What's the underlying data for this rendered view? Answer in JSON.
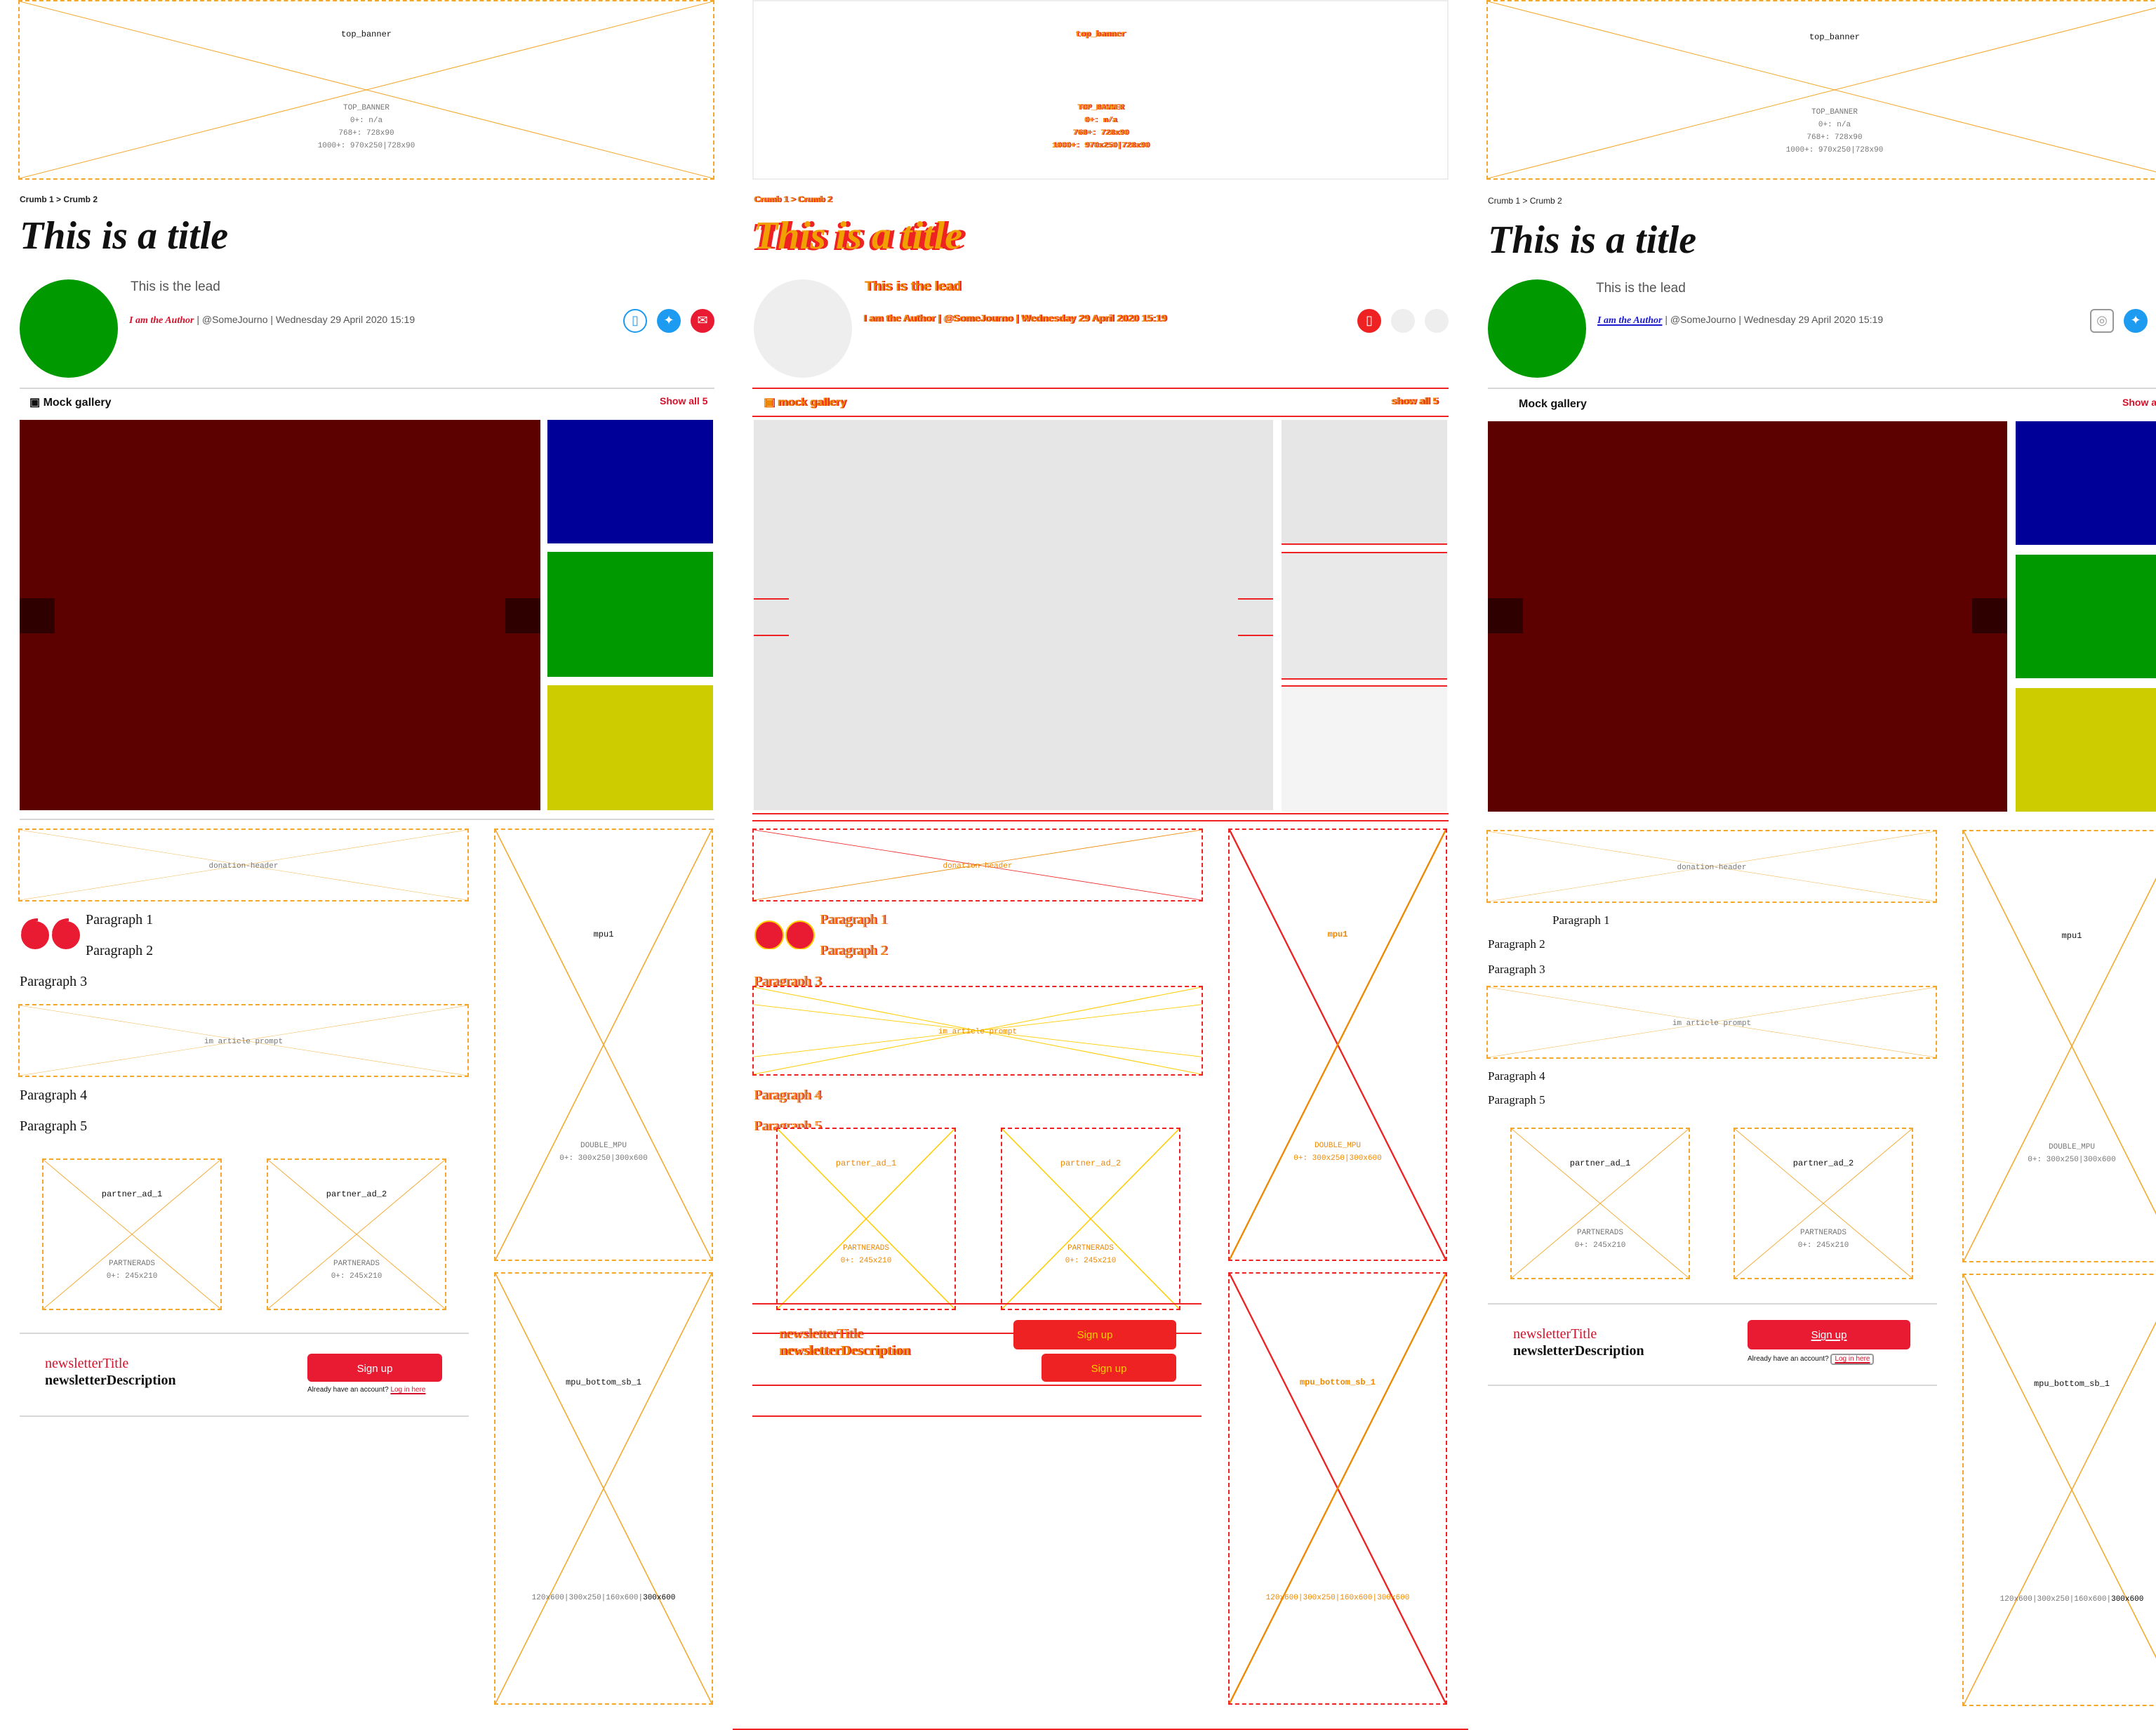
{
  "top_banner": {
    "name": "top_banner",
    "info": [
      "TOP_BANNER",
      "0+: n/a",
      "768+: 728x90",
      "1000+: 970x250|728x90"
    ]
  },
  "breadcrumb": "Crumb 1 > Crumb 2",
  "title": "This is a title",
  "lead": "This is the lead",
  "byline": {
    "author": "I am the Author",
    "rest": " | @SomeJourno | Wednesday 29 April 2020 15:19"
  },
  "gallery": {
    "title": "Mock gallery",
    "title_diff": "mock gallery",
    "show_all": "Show all 5",
    "show_all_diff": "show all 5",
    "main_color": "#5c0000",
    "thumb_colors": [
      "#000099",
      "#009900",
      "#cccc00"
    ]
  },
  "donation": {
    "name": "donation-header"
  },
  "prompt": {
    "name": "im article prompt"
  },
  "paragraphs": [
    "Paragraph 1",
    "Paragraph 2",
    "Paragraph 3",
    "Paragraph 4",
    "Paragraph 5"
  ],
  "partner_ads": [
    {
      "name": "partner_ad_1",
      "info": [
        "PARTNERADS",
        "0+: 245x210"
      ]
    },
    {
      "name": "partner_ad_2",
      "info": [
        "PARTNERADS",
        "0+: 245x210"
      ]
    }
  ],
  "newsletter": {
    "title": "newsletterTitle",
    "description": "newsletterDescription",
    "signup": "Sign up",
    "already": "Already have an account?",
    "login": "Log in here"
  },
  "mpu1": {
    "name": "mpu1",
    "info": [
      "DOUBLE_MPU",
      "0+: 300x250|300x600"
    ]
  },
  "mpu_bottom": {
    "name": "mpu_bottom_sb_1",
    "info_prefix": "120x600|300x250|160x600|",
    "info_bold": "300x600"
  },
  "colors": {
    "accent": "#e91b33",
    "placeholder_border": "#f3a82c",
    "avatar": "#009900",
    "twitter": "#1d9bf0",
    "diff_red": "#ee2222",
    "diff_yellow": "#ffcc00"
  },
  "icons": [
    "gallery-icon",
    "bookmark-icon",
    "twitter-icon",
    "email-icon",
    "quote-icon",
    "chevron-left-icon",
    "chevron-right-icon"
  ]
}
